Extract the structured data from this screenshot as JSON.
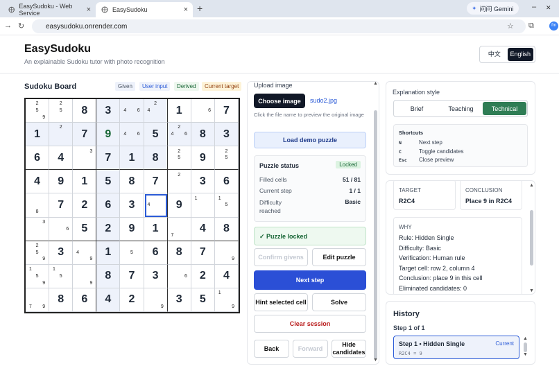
{
  "browser": {
    "tabs": [
      {
        "title": "EasySudoku - Web Service",
        "active": false
      },
      {
        "title": "EasySudoku",
        "active": true
      }
    ],
    "gemini_label": "问问 Gemini",
    "url": "easysudoku.onrender.com"
  },
  "header": {
    "title": "EasySudoku",
    "subtitle": "An explainable Sudoku tutor with photo recognition",
    "lang_zh": "中文",
    "lang_en": "English"
  },
  "board": {
    "title": "Sudoku Board",
    "legend": [
      {
        "label": "Given",
        "bg": "#eef2fb",
        "color": "#4b5563"
      },
      {
        "label": "User input",
        "bg": "#eef2fb",
        "color": "#2b5bd7"
      },
      {
        "label": "Derived",
        "bg": "#edf7ee",
        "color": "#166534"
      },
      {
        "label": "Current target",
        "bg": "#fdf3d8",
        "color": "#92400e"
      }
    ],
    "rows": [
      [
        "c:259",
        "c:25",
        "8",
        "3",
        "c:46",
        "c:24",
        "1",
        "c:6",
        "7"
      ],
      [
        "1",
        "c:2",
        "7",
        "D:9",
        "c:46",
        "5",
        "c:246",
        "8",
        "3"
      ],
      [
        "6",
        "4",
        "c:3",
        "7",
        "1",
        "8",
        "c:25",
        "9",
        "c:25"
      ],
      [
        "4",
        "9",
        "1",
        "5",
        "8",
        "7",
        "c:2",
        "3",
        "6"
      ],
      [
        "c:8",
        "7",
        "2",
        "6",
        "3",
        "S:4",
        "9",
        "c:1",
        "c:15"
      ],
      [
        "c:3",
        "c:6",
        "5",
        "2",
        "9",
        "1",
        "c:7",
        "4",
        "8"
      ],
      [
        "c:259",
        "3",
        "c:49",
        "1",
        "c:5",
        "6",
        "8",
        "7",
        "c:9"
      ],
      [
        "c:159",
        "c:15",
        "c:9",
        "8",
        "7",
        "3",
        "c:6",
        "2",
        "4"
      ],
      [
        "c:79",
        "8",
        "6",
        "4",
        "2",
        "c:9",
        "3",
        "5",
        "c:19"
      ]
    ]
  },
  "controls": {
    "upload_label": "Upload image",
    "choose_image": "Choose image",
    "file_name": "sudo2.jpg",
    "file_hint": "Click the file name to preview the original image",
    "load_demo": "Load demo puzzle",
    "status_title": "Puzzle status",
    "status_badge": "Locked",
    "filled_label": "Filled cells",
    "filled_value": "51 / 81",
    "step_label": "Current step",
    "step_value": "1 / 1",
    "difficulty_label": "Difficulty reached",
    "difficulty_value": "Basic",
    "locked_msg": "✓ Puzzle locked",
    "confirm_givens": "Confirm givens",
    "edit_puzzle": "Edit puzzle",
    "next_step": "Next step",
    "hint_cell": "Hint selected cell",
    "solve": "Solve",
    "clear_session": "Clear session",
    "back": "Back",
    "forward": "Forward",
    "hide_candidates": "Hide candidates"
  },
  "explanation": {
    "style_label": "Explanation style",
    "styles": [
      "Brief",
      "Teaching",
      "Technical"
    ],
    "active_style": "Technical",
    "shortcuts_title": "Shortcuts",
    "shortcuts": [
      {
        "key": "N",
        "desc": "Next step"
      },
      {
        "key": "C",
        "desc": "Toggle candidates"
      },
      {
        "key": "Esc",
        "desc": "Close preview"
      }
    ],
    "target_label": "TARGET",
    "target_value": "R2C4",
    "conclusion_label": "CONCLUSION",
    "conclusion_value": "Place 9 in R2C4",
    "why_label": "WHY",
    "why_lines": [
      "Rule: Hidden Single",
      "Difficulty: Basic",
      "Verification: Human rule",
      "Target cell: row 2, column 4",
      "Conclusion: place 9 in this cell",
      "Eliminated candidates: 0"
    ]
  },
  "history": {
    "title": "History",
    "step_count": "Step 1 of 1",
    "items": [
      {
        "title": "Step 1 • Hidden Single",
        "badge": "Current",
        "detail": "R2C4 = 9"
      }
    ]
  }
}
